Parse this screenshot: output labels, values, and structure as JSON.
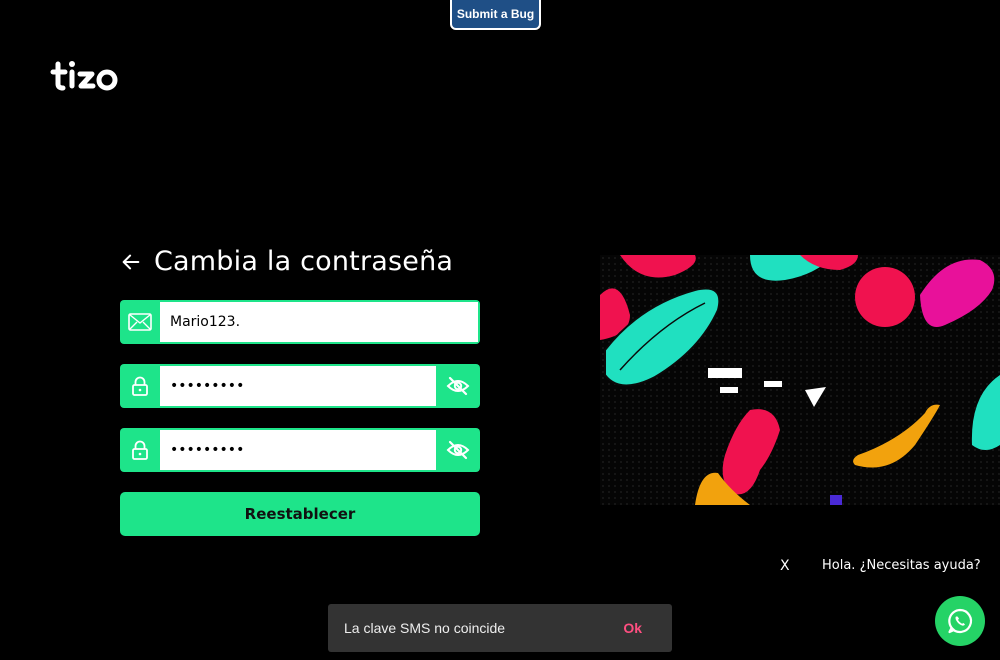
{
  "bug_button": {
    "label": "Submit a Bug"
  },
  "logo": {
    "name": "tizo-logo"
  },
  "form": {
    "title": "Cambia la contraseña",
    "email_value": "Mario123.",
    "password_value": "•••••••••",
    "confirm_value": "•••••••••",
    "submit_label": "Reestablecer"
  },
  "chat": {
    "close_label": "X",
    "prompt": "Hola. ¿Necesitas ayuda?"
  },
  "toast": {
    "message": "La clave SMS no coincide",
    "action": "Ok"
  },
  "colors": {
    "accent": "#1ee48a",
    "toast_action": "#ff4f81",
    "whatsapp": "#25d366"
  },
  "icons": [
    "back-arrow-icon",
    "envelope-icon",
    "lock-icon",
    "eye-slash-icon",
    "whatsapp-icon"
  ]
}
